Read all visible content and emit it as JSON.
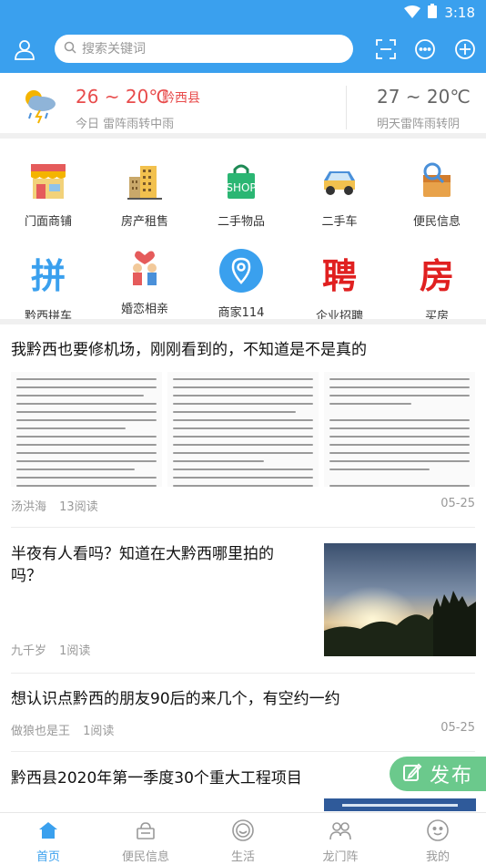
{
  "status_bar": {
    "time": "3:18"
  },
  "header": {
    "search_placeholder": "搜索关键词",
    "icons": [
      "user-icon",
      "scan-icon",
      "message-icon",
      "add-icon"
    ]
  },
  "weather": {
    "today": {
      "temp": "26 ~ 20℃",
      "county": "黔西县",
      "desc": "今日 雷阵雨转中雨",
      "icon": "thunderstorm-rain-icon"
    },
    "tomorrow": {
      "temp": "27 ~ 20℃",
      "desc": "明天雷阵雨转阴"
    }
  },
  "categories": [
    {
      "label": "门面商铺",
      "icon": "storefront-icon"
    },
    {
      "label": "房产租售",
      "icon": "building-icon"
    },
    {
      "label": "二手物品",
      "icon": "shopping-bag-icon"
    },
    {
      "label": "二手车",
      "icon": "car-icon"
    },
    {
      "label": "便民信息",
      "icon": "info-search-icon"
    },
    {
      "label": "黔西拼车",
      "icon": "pin-char-icon"
    },
    {
      "label": "婚恋相亲",
      "icon": "couple-icon"
    },
    {
      "label": "商家114",
      "icon": "location-pin-icon"
    },
    {
      "label": "企业招聘",
      "icon": "recruit-char-icon"
    },
    {
      "label": "买房",
      "icon": "house-char-icon"
    }
  ],
  "big_chars": {
    "pin": "拼",
    "recruit": "聘",
    "house": "房"
  },
  "posts": [
    {
      "title": "我黔西也要修机场，刚刚看到的，不知道是不是真的",
      "author": "汤洪海",
      "reads": "13阅读",
      "date": "05-25"
    },
    {
      "title": "半夜有人看吗？知道在大黔西哪里拍的吗？",
      "author": "九千岁",
      "reads": "1阅读",
      "date": ""
    },
    {
      "title": "想认识点黔西的朋友90后的来几个，有空约一约",
      "author": "做狼也是王",
      "reads": "1阅读",
      "date": "05-25"
    },
    {
      "title": "黔西县2020年第一季度30个重大工程项目",
      "author": "",
      "reads": "",
      "date": ""
    }
  ],
  "fab": {
    "label": "发布"
  },
  "tabs": [
    {
      "label": "首页",
      "icon": "home-icon",
      "active": true
    },
    {
      "label": "便民信息",
      "icon": "info-icon",
      "active": false
    },
    {
      "label": "生活",
      "icon": "life-icon",
      "active": false
    },
    {
      "label": "龙门阵",
      "icon": "chat-group-icon",
      "active": false
    },
    {
      "label": "我的",
      "icon": "profile-icon",
      "active": false
    }
  ],
  "colors": {
    "primary": "#3aa0ee",
    "temp_red": "#e84c4c",
    "fab_green": "#6bc98c"
  }
}
